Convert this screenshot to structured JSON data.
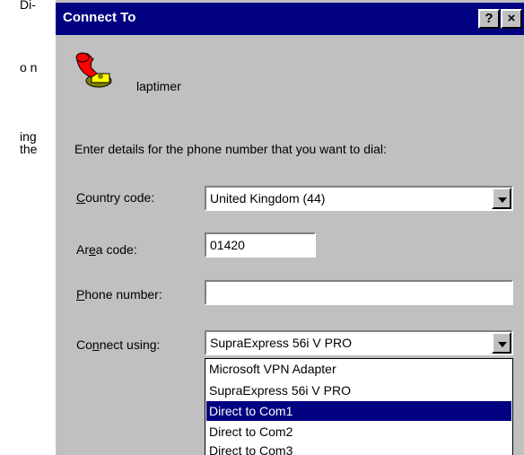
{
  "background_fragments": [
    "Di-",
    "o n",
    "ing",
    "the"
  ],
  "dialog": {
    "title": "Connect To",
    "help_button": "?",
    "close_button": "×",
    "connection_name": "laptimer",
    "instruction": "Enter details for the phone number that you want to dial:"
  },
  "form": {
    "country_code": {
      "label_pre": "",
      "label_accel": "C",
      "label_post": "ountry code:",
      "value": "United Kingdom (44)"
    },
    "area_code": {
      "label_pre": "Ar",
      "label_accel": "e",
      "label_post": "a code:",
      "value": "01420"
    },
    "phone_number": {
      "label_pre": "",
      "label_accel": "P",
      "label_post": "hone number:",
      "value": ""
    },
    "connect_using": {
      "label_pre": "Co",
      "label_accel": "n",
      "label_post": "nect using:",
      "value": "SupraExpress 56i V PRO"
    }
  },
  "dropdown_options": [
    {
      "label": "Microsoft VPN Adapter",
      "selected": false
    },
    {
      "label": "SupraExpress 56i V PRO",
      "selected": false
    },
    {
      "label": "Direct to Com1",
      "selected": true
    },
    {
      "label": "Direct to Com2",
      "selected": false
    },
    {
      "label": "Direct to Com3",
      "selected": false
    }
  ],
  "colors": {
    "titlebar": "#000080",
    "dialog_face": "#c0c0c0",
    "selection": "#000080"
  },
  "icons": {
    "connection": "telephone-icon"
  }
}
